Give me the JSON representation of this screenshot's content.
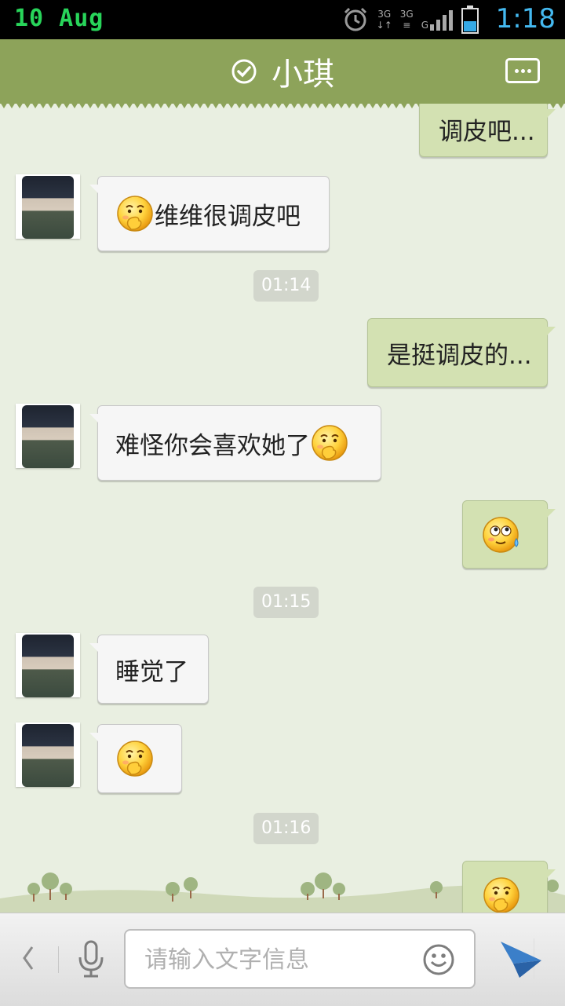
{
  "status_bar": {
    "date": "10 Aug",
    "network_1": "3G",
    "network_2": "3G",
    "network_3": "G",
    "time": "1:18"
  },
  "header": {
    "contact_name": "小琪"
  },
  "messages": [
    {
      "side": "right",
      "text": "调皮吧..."
    },
    {
      "side": "left",
      "text": "维维很调皮吧",
      "emoji": "blush-hand-emoji"
    },
    {
      "side": "time",
      "text": "01:14"
    },
    {
      "side": "right",
      "text": "是挺调皮的..."
    },
    {
      "side": "left",
      "text": "难怪你会喜欢她了",
      "emoji": "blush-hand-emoji"
    },
    {
      "side": "right",
      "emoji": "sweat-emoji"
    },
    {
      "side": "time",
      "text": "01:15"
    },
    {
      "side": "left",
      "text": "睡觉了"
    },
    {
      "side": "left",
      "emoji": "blush-hand-emoji"
    },
    {
      "side": "time",
      "text": "01:16"
    },
    {
      "side": "right",
      "emoji": "blush-hand-emoji"
    }
  ],
  "input": {
    "placeholder": "请输入文字信息"
  },
  "colors": {
    "header": "#8da35a",
    "bubble_right": "#d3e1b2",
    "bubble_left": "#f6f6f6",
    "background": "#e9efe1",
    "send": "#3b7fc9"
  }
}
